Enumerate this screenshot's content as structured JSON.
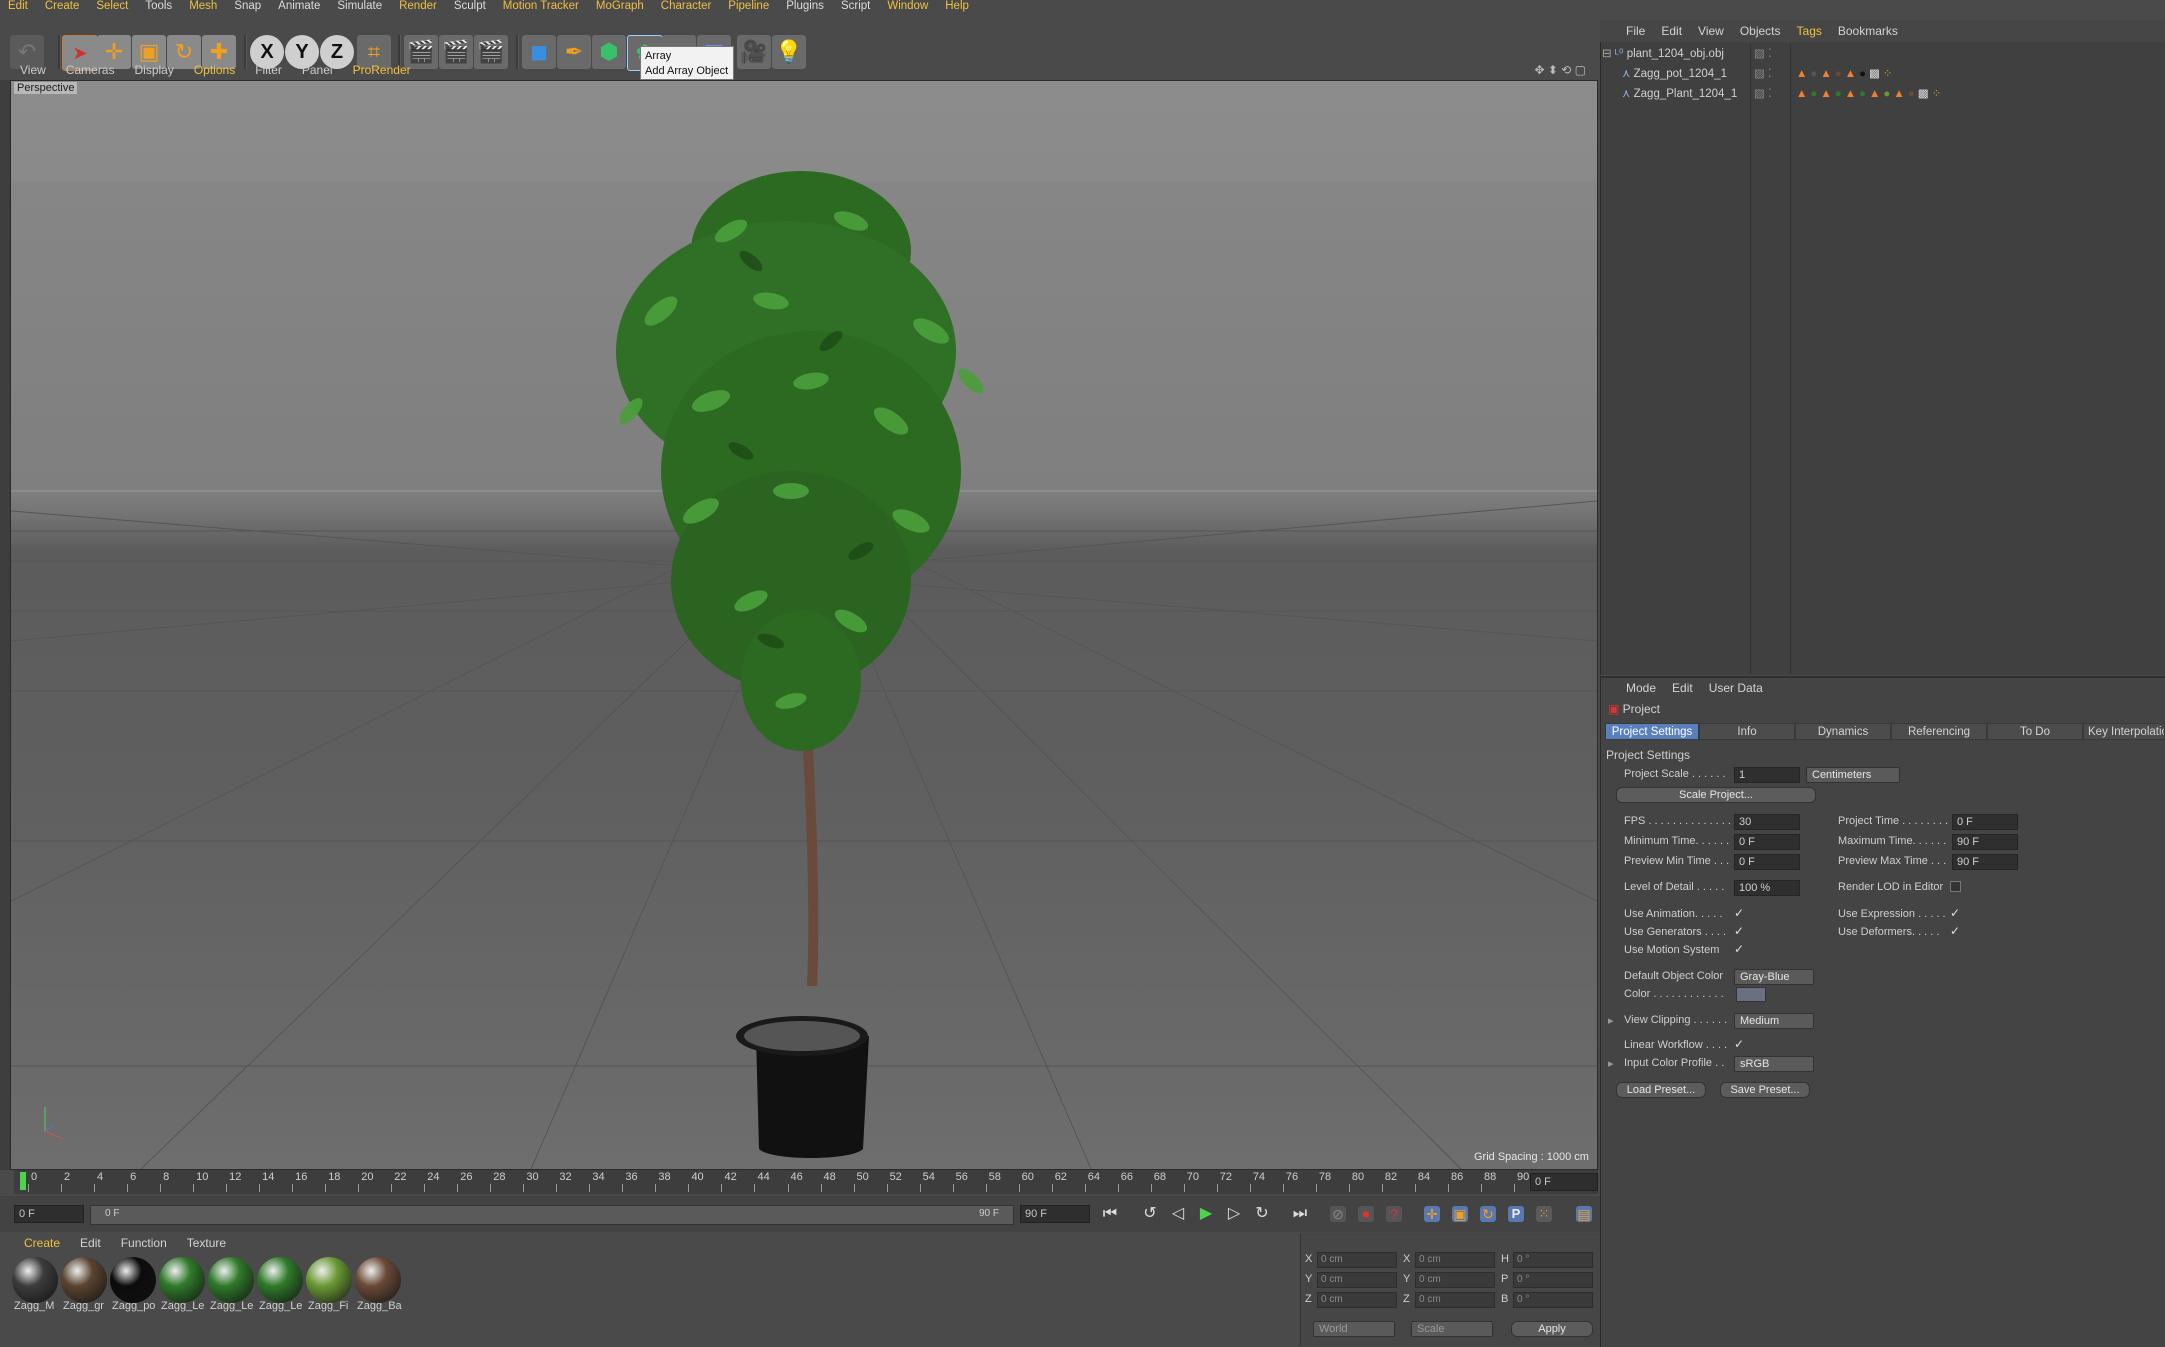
{
  "menubar": [
    "Edit",
    "Create",
    "Select",
    "Tools",
    "Mesh",
    "Snap",
    "Animate",
    "Simulate",
    "Render",
    "Sculpt",
    "Motion Tracker",
    "MoGraph",
    "Character",
    "Pipeline",
    "Plugins",
    "Script",
    "Window",
    "Help"
  ],
  "toolbar": {
    "axis_x": "X",
    "axis_y": "Y",
    "axis_z": "Z",
    "tooltip_title": "Array",
    "tooltip_desc": "Add Array Object"
  },
  "viewport": {
    "menu": [
      "View",
      "Cameras",
      "Display",
      "Options",
      "Filter",
      "Panel",
      "ProRender"
    ],
    "label": "Perspective",
    "grid_spacing": "Grid Spacing : 1000 cm"
  },
  "timeline": {
    "ticks": [
      "0",
      "2",
      "4",
      "6",
      "8",
      "10",
      "12",
      "14",
      "16",
      "18",
      "20",
      "22",
      "24",
      "26",
      "28",
      "30",
      "32",
      "34",
      "36",
      "38",
      "40",
      "42",
      "44",
      "46",
      "48",
      "50",
      "52",
      "54",
      "56",
      "58",
      "60",
      "62",
      "64",
      "66",
      "68",
      "70",
      "72",
      "74",
      "76",
      "78",
      "80",
      "82",
      "84",
      "86",
      "88",
      "90"
    ],
    "current_frame": "0 F",
    "start": "0 F",
    "range_start": "0 F",
    "range_end": "90 F",
    "end": "90 F"
  },
  "materials": {
    "menu": [
      "Create",
      "Edit",
      "Function",
      "Texture"
    ],
    "items": [
      {
        "label": "Zagg_M",
        "color": "#3c3c3c"
      },
      {
        "label": "Zagg_gr",
        "color": "#5a4430"
      },
      {
        "label": "Zagg_po",
        "color": "#0c0c0c"
      },
      {
        "label": "Zagg_Le",
        "color": "#2f7a2a"
      },
      {
        "label": "Zagg_Le",
        "color": "#2f7a2a"
      },
      {
        "label": "Zagg_Le",
        "color": "#2f7a2a"
      },
      {
        "label": "Zagg_Fi",
        "color": "#6b9a35"
      },
      {
        "label": "Zagg_Ba",
        "color": "#6a4a38"
      }
    ]
  },
  "coords": {
    "x_pos": "0 cm",
    "y_pos": "0 cm",
    "z_pos": "0 cm",
    "x_size": "0 cm",
    "y_size": "0 cm",
    "z_size": "0 cm",
    "h": "0 °",
    "p": "0 °",
    "b": "0 °",
    "mode1": "World",
    "mode2": "Scale",
    "apply": "Apply"
  },
  "object_manager": {
    "menu": [
      "File",
      "Edit",
      "View",
      "Objects",
      "Tags",
      "Bookmarks"
    ],
    "objects": [
      "plant_1204_obj.obj",
      "Zagg_pot_1204_1",
      "Zagg_Plant_1204_1"
    ]
  },
  "attribute_manager": {
    "menu": [
      "Mode",
      "Edit",
      "User Data"
    ],
    "title": "Project",
    "tabs": [
      "Project Settings",
      "Info",
      "Dynamics",
      "Referencing",
      "To Do",
      "Key Interpolation"
    ],
    "section": "Project Settings",
    "project_scale_label": "Project Scale . . . . . .",
    "project_scale": "1",
    "project_scale_unit": "Centimeters",
    "scale_project_btn": "Scale Project...",
    "fps_label": "FPS . . . . . . . . . . . . . . .",
    "fps": "30",
    "project_time_label": "Project Time . . . . . . . .",
    "project_time": "0 F",
    "min_time_label": "Minimum Time. . . . . .",
    "min_time": "0 F",
    "max_time_label": "Maximum Time. . . . . .",
    "max_time": "90 F",
    "prev_min_label": "Preview Min Time . . .",
    "prev_min": "0 F",
    "prev_max_label": "Preview Max Time . . .",
    "prev_max": "90 F",
    "lod_label": "Level of Detail . . . . .",
    "lod": "100 %",
    "render_lod_label": "Render LOD in Editor",
    "use_animation": "Use Animation. . . . .",
    "use_expression": "Use Expression . . . . .",
    "use_generators": "Use Generators . . . .",
    "use_deformers": "Use Deformers. . . . .",
    "use_motion": "Use Motion System",
    "default_color_label": "Default Object Color",
    "default_color": "Gray-Blue",
    "color_label": "Color . . . . . . . . . . . .",
    "view_clipping_label": "View Clipping . . . . . .",
    "view_clipping": "Medium",
    "linear_workflow": "Linear Workflow . . . .",
    "input_color_label": "Input Color Profile . .",
    "input_color": "sRGB",
    "load_preset": "Load Preset...",
    "save_preset": "Save Preset..."
  }
}
